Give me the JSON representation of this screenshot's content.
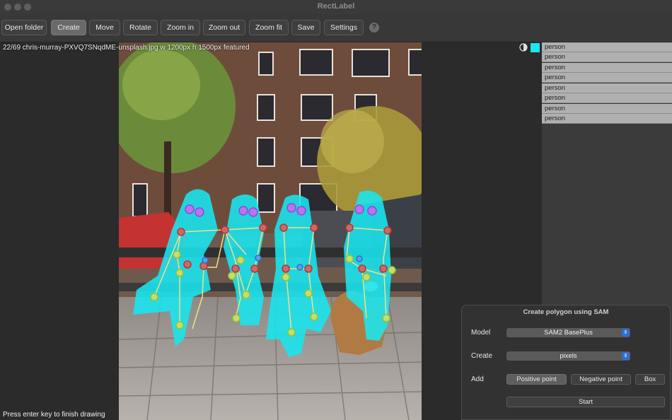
{
  "window": {
    "title": "RectLabel"
  },
  "toolbar": {
    "open_folder": "Open folder",
    "create": "Create",
    "move": "Move",
    "rotate": "Rotate",
    "zoom_in": "Zoom in",
    "zoom_out": "Zoom out",
    "zoom_fit": "Zoom fit",
    "save": "Save",
    "settings": "Settings",
    "help": "?"
  },
  "image": {
    "info": "22/69 chris-murray-PXVQ7SNqdME-unsplash.jpg w 1200px h 1500px featured",
    "hint": "Press enter key to finish drawing"
  },
  "labels": {
    "accent_color": "#19e6f0",
    "items": [
      "person",
      "person",
      "person",
      "person",
      "person",
      "person",
      "person",
      "person"
    ]
  },
  "sam": {
    "title": "Create polygon using SAM",
    "model_label": "Model",
    "model_value": "SAM2 BasePlus",
    "create_label": "Create",
    "create_value": "pixels",
    "add_label": "Add",
    "positive": "Positive point",
    "negative": "Negative point",
    "box": "Box",
    "start": "Start"
  }
}
